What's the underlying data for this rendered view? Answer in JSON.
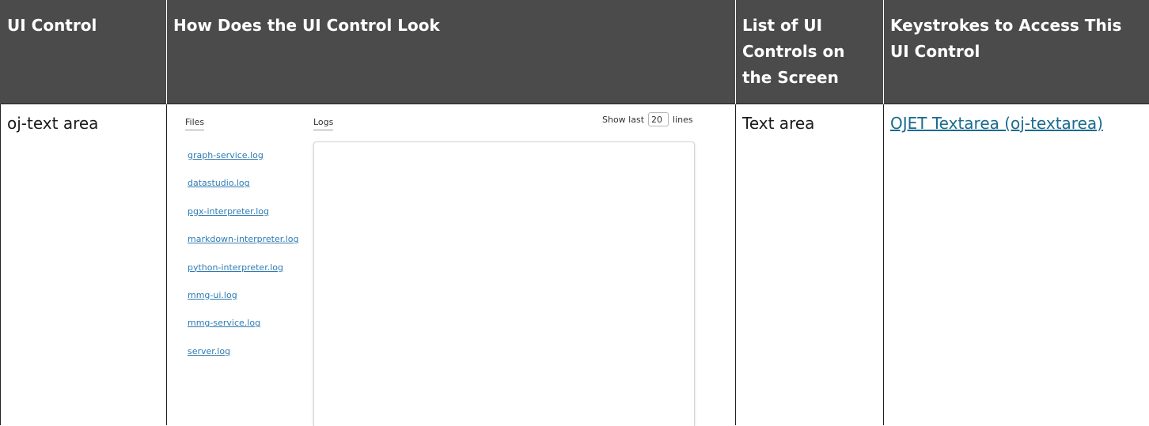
{
  "table": {
    "headers": [
      "UI Control",
      "How Does the UI Control Look",
      "List of UI Controls on the Screen",
      "Keystrokes to Access This UI Control"
    ],
    "row": {
      "control": "oj-text area",
      "controls_list": "Text area",
      "keystrokes_link": "OJET Textarea (oj-textarea)"
    }
  },
  "screenshot": {
    "files_label": "Files",
    "logs_label": "Logs",
    "show_last_label": "Show last",
    "lines_value": "20",
    "lines_label": "lines",
    "files": [
      "graph-service.log",
      "datastudio.log",
      "pgx-interpreter.log",
      "markdown-interpreter.log",
      "python-interpreter.log",
      "mmg-ui.log",
      "mmg-service.log",
      "server.log"
    ]
  },
  "colors": {
    "header_bg": "#4b4b4b",
    "header_text": "#ffffff",
    "link": "#1a6b8e",
    "file_link": "#2f7bb3"
  }
}
